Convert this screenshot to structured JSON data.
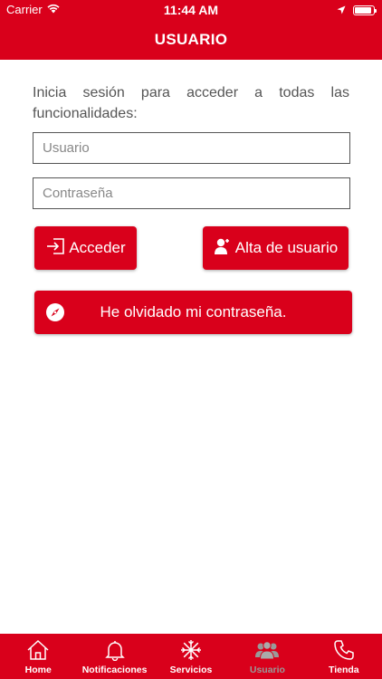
{
  "status_bar": {
    "carrier": "Carrier",
    "time": "11:44 AM",
    "battery_level": 0.9
  },
  "nav": {
    "title": "USUARIO"
  },
  "intro": {
    "text": "Inicia sesión para acceder a todas las funcionalidades:"
  },
  "form": {
    "user_placeholder": "Usuario",
    "user_value": "",
    "password_placeholder": "Contraseña",
    "password_value": ""
  },
  "buttons": {
    "login_label": "Acceder",
    "register_label": "Alta de usuario",
    "forgot_label": "He olvidado mi contraseña."
  },
  "tabbar": {
    "items": [
      {
        "label": "Home",
        "icon": "home-icon"
      },
      {
        "label": "Notificaciones",
        "icon": "bell-icon"
      },
      {
        "label": "Servicios",
        "icon": "services-icon"
      },
      {
        "label": "Usuario",
        "icon": "users-icon",
        "active": true
      },
      {
        "label": "Tienda",
        "icon": "phone-icon"
      }
    ]
  },
  "colors": {
    "brand": "#d9001b",
    "inactive_tab": "#999999"
  }
}
